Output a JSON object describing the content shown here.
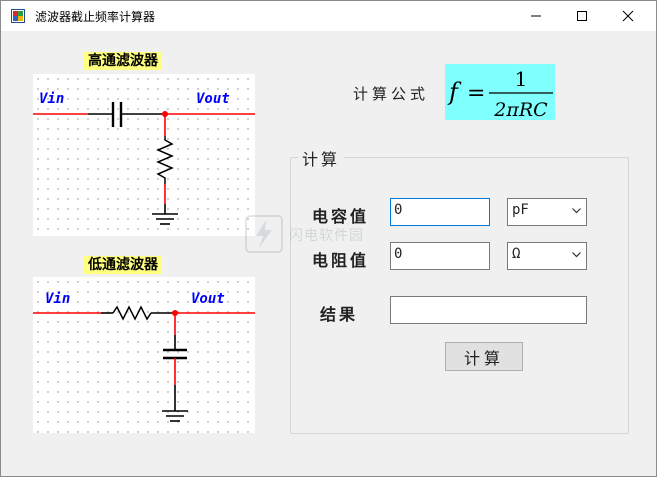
{
  "window": {
    "title": "滤波器截止频率计算器",
    "icon": "app-icon"
  },
  "titlebar_buttons": {
    "minimize": "minimize-icon",
    "maximize": "maximize-icon",
    "close": "close-icon"
  },
  "highpass": {
    "title": "高通滤波器",
    "vin": "Vin",
    "vout": "Vout"
  },
  "lowpass": {
    "title": "低通滤波器",
    "vin": "Vin",
    "vout": "Vout"
  },
  "formula": {
    "label": "计算公式",
    "lhs": "f",
    "eq": "=",
    "numerator": "1",
    "denominator": "2πRC",
    "bg": "#80ffff"
  },
  "calc": {
    "group_title": "计算",
    "capacitance": {
      "label": "电容值",
      "value": "0",
      "unit": "pF"
    },
    "resistance": {
      "label": "电阻值",
      "value": "0",
      "unit": "Ω"
    },
    "result": {
      "label": "结果",
      "value": ""
    },
    "button": "计算"
  },
  "watermark": {
    "text": "闪电软件园"
  },
  "colors": {
    "wire": "#ff0000",
    "node": "#ff0000",
    "label_blue": "#0000ff",
    "title_bg": "#ffff80"
  }
}
